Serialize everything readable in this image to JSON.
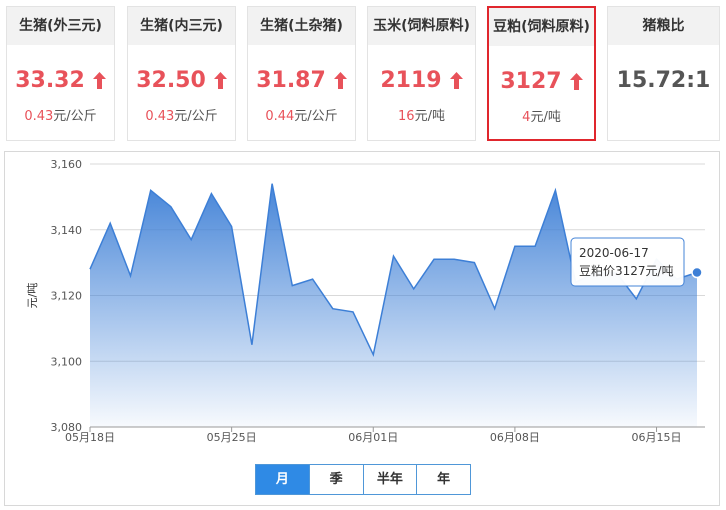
{
  "cards": [
    {
      "title": "生猪(外三元)",
      "price": "33.32",
      "change": "0.43",
      "unit": "元/公斤",
      "direction": "up"
    },
    {
      "title": "生猪(内三元)",
      "price": "32.50",
      "change": "0.43",
      "unit": "元/公斤",
      "direction": "up"
    },
    {
      "title": "生猪(土杂猪)",
      "price": "31.87",
      "change": "0.44",
      "unit": "元/公斤",
      "direction": "up"
    },
    {
      "title": "玉米(饲料原料)",
      "price": "2119",
      "change": "16",
      "unit": "元/吨",
      "direction": "up"
    },
    {
      "title": "豆粕(饲料原料)",
      "price": "3127",
      "change": "4",
      "unit": "元/吨",
      "direction": "up",
      "selected": true
    },
    {
      "title": "猪粮比",
      "price": "15.72:1"
    }
  ],
  "colors": {
    "up": "#e8525a",
    "line": "#3d7fd6",
    "selected_border": "#e0262d",
    "tab_active": "#2f8ae5"
  },
  "icons": {
    "up": "arrow-up-icon"
  },
  "chart_data": {
    "type": "area",
    "title": "",
    "xlabel": "",
    "ylabel": "元/吨",
    "ylim": [
      3080,
      3160
    ],
    "yticks": [
      "3,080",
      "3,100",
      "3,120",
      "3,140",
      "3,160"
    ],
    "yticks_values": [
      3080,
      3100,
      3120,
      3140,
      3160
    ],
    "x_tick_labels": [
      "05月18日",
      "05月25日",
      "06月01日",
      "06月08日",
      "06月15日"
    ],
    "grid": true,
    "x": [
      "2020-05-18",
      "2020-05-19",
      "2020-05-20",
      "2020-05-21",
      "2020-05-22",
      "2020-05-23",
      "2020-05-24",
      "2020-05-25",
      "2020-05-26",
      "2020-05-27",
      "2020-05-28",
      "2020-05-29",
      "2020-05-30",
      "2020-05-31",
      "2020-06-01",
      "2020-06-02",
      "2020-06-03",
      "2020-06-04",
      "2020-06-05",
      "2020-06-06",
      "2020-06-07",
      "2020-06-08",
      "2020-06-09",
      "2020-06-10",
      "2020-06-11",
      "2020-06-12",
      "2020-06-13",
      "2020-06-14",
      "2020-06-15",
      "2020-06-16",
      "2020-06-17"
    ],
    "series": [
      {
        "values": [
          3128,
          3142,
          3126,
          3152,
          3147,
          3137,
          3151,
          3141,
          3105,
          3154,
          3123,
          3125,
          3116,
          3115,
          3102,
          3132,
          3122,
          3131,
          3131,
          3130,
          3116,
          3135,
          3135,
          3152,
          3124,
          3127,
          3127,
          3119,
          3131,
          3125,
          3127
        ]
      }
    ],
    "tooltip": {
      "date": "2020-06-17",
      "label": "豆粕价3127元/吨"
    }
  },
  "range_tabs": [
    {
      "label": "月",
      "active": true
    },
    {
      "label": "季",
      "active": false
    },
    {
      "label": "半年",
      "active": false
    },
    {
      "label": "年",
      "active": false
    }
  ]
}
